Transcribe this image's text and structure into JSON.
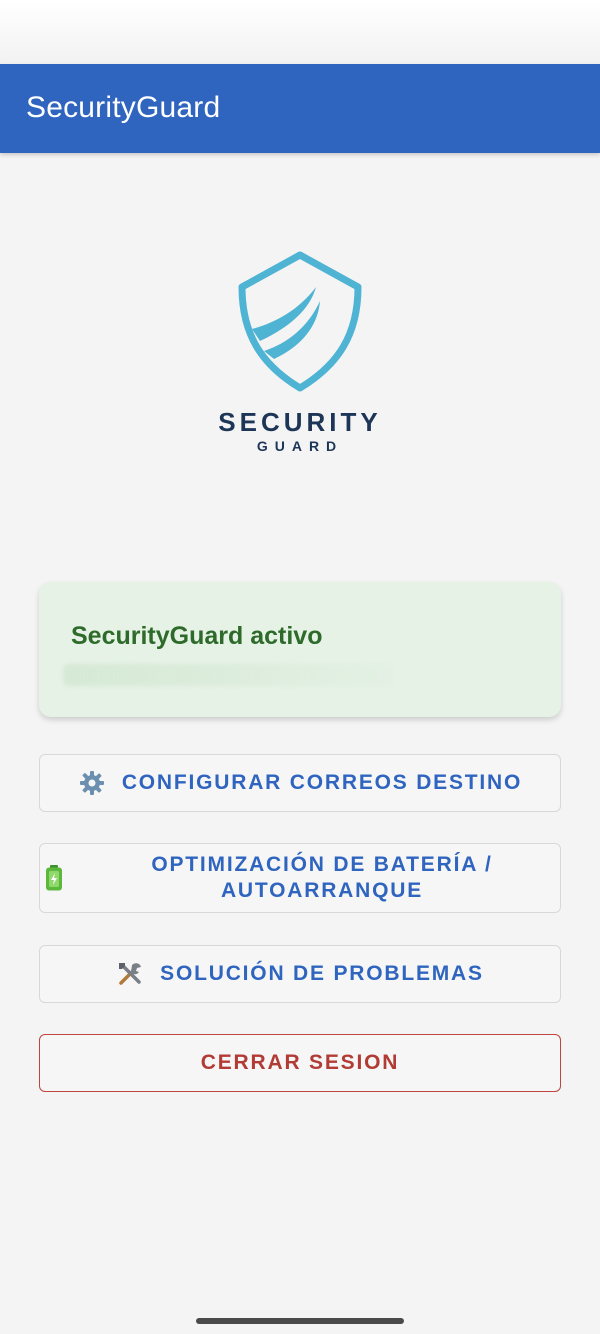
{
  "app_bar": {
    "title": "SecurityGuard",
    "color": "#2f65bf"
  },
  "logo": {
    "line1": "SECURITY",
    "line2": "GUARD",
    "shield_color": "#4fb3d3"
  },
  "status_card": {
    "title": "SecurityGuard activo",
    "background": "#e6f2e6",
    "text_color": "#2e6b2b"
  },
  "buttons": [
    {
      "icon": "gear-icon",
      "label": "CONFIGURAR CORREOS DESTINO"
    },
    {
      "icon": "battery-icon",
      "label": "OPTIMIZACIÓN DE BATERÍA / AUTOARRANQUE"
    },
    {
      "icon": "tools-icon",
      "label": "SOLUCIÓN DE PROBLEMAS"
    }
  ],
  "logout": {
    "label": "CERRAR SESION",
    "color": "#b23b35"
  }
}
